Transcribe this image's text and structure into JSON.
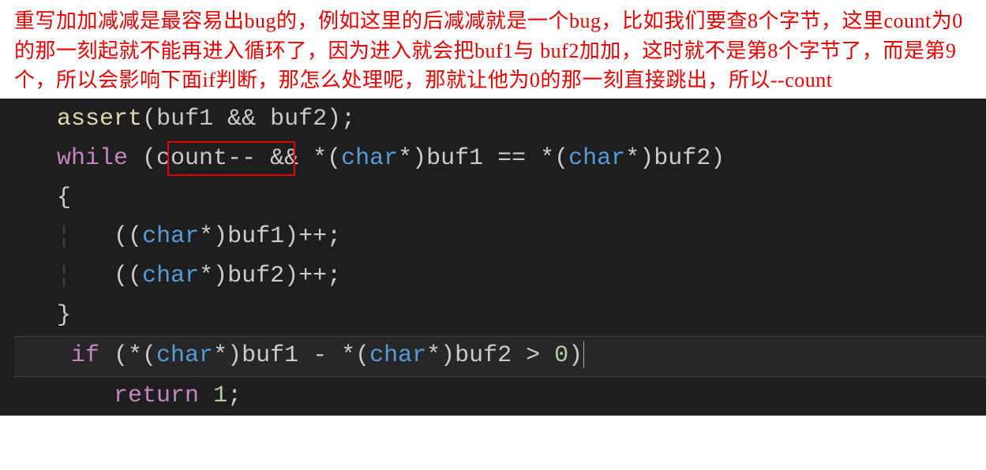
{
  "comment": "重写加加减减是最容易出bug的，例如这里的后减减就是一个bug，比如我们要查8个字节，这里count为0的那一刻起就不能再进入循环了，因为进入就会把buf1与 buf2加加，这时就不是第8个字节了，而是第9个，所以会影响下面if判断，那怎么处理呢，那就让他为0的那一刻直接跳出，所以--count",
  "code": {
    "line1": {
      "fn": "assert",
      "id1": "buf1",
      "op": " && ",
      "id2": "buf2"
    },
    "line2": {
      "kw": "while",
      "id1": "count",
      "dec": "--",
      "op2": " && *(",
      "type1": "char",
      "mid": "*)buf1 == *(",
      "type2": "char",
      "end": "*)buf2)"
    },
    "line3": {
      "brace": "{"
    },
    "line4": {
      "pre": "((",
      "type": "char",
      "rest": "*)buf1)++;"
    },
    "line5": {
      "pre": "((",
      "type": "char",
      "rest": "*)buf2)++;"
    },
    "line6": {
      "brace": "}"
    },
    "line7": {
      "kw": "if",
      "pre": " (*(",
      "type1": "char",
      "mid": "*)buf1 - *(",
      "type2": "char",
      "end": "*)buf2 > ",
      "num": "0",
      "close": ")"
    },
    "line8": {
      "kw": "return",
      "num": "1"
    }
  }
}
